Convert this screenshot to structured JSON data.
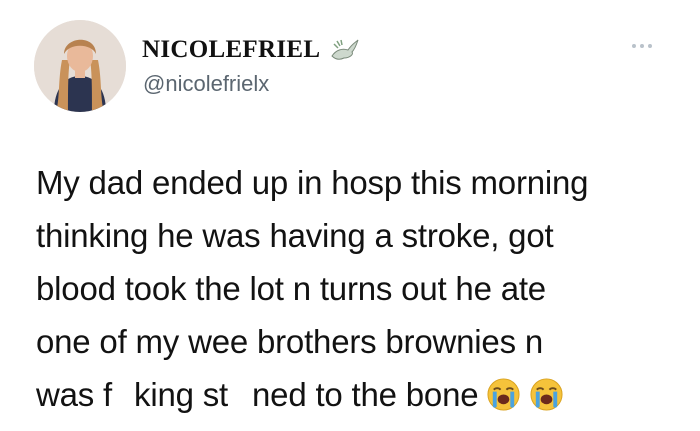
{
  "tweet": {
    "display_name": "NICOLEFRIEL",
    "handle": "@nicolefrielx",
    "badge_icon": "dove-icon",
    "more_icon": "more-icon",
    "text_lines": [
      "My dad ended up in hosp this morning",
      "thinking he was having a stroke, got",
      "blood took the lot n turns out he ate",
      "one of my wee brothers brownies n"
    ],
    "last_line": {
      "part1": "was f",
      "part2": "king st",
      "part3": "ned to the bone"
    },
    "emojis": [
      "loudly-crying-face-icon",
      "loudly-crying-face-icon"
    ]
  },
  "colors": {
    "background": "#ffffff",
    "text": "#121212",
    "handle": "#5b6670",
    "emoji_face": "#f5c33b",
    "tears": "#4aa3df"
  }
}
